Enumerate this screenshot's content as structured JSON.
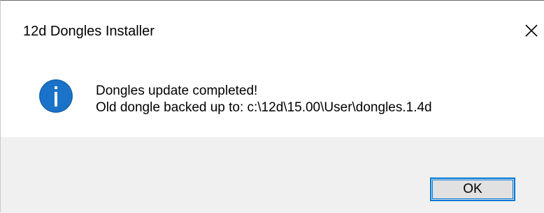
{
  "window": {
    "title": "12d Dongles Installer"
  },
  "icon": {
    "name": "info-icon",
    "color": "#1a73c8",
    "glyph": "i"
  },
  "message": {
    "line1": "Dongles update completed!",
    "line2": "Old dongle backed up to: c:\\12d\\15.00\\User\\dongles.1.4d"
  },
  "buttons": {
    "ok_label": "OK"
  },
  "colors": {
    "accent": "#0078d7",
    "footer_bg": "#f0f0f0"
  }
}
